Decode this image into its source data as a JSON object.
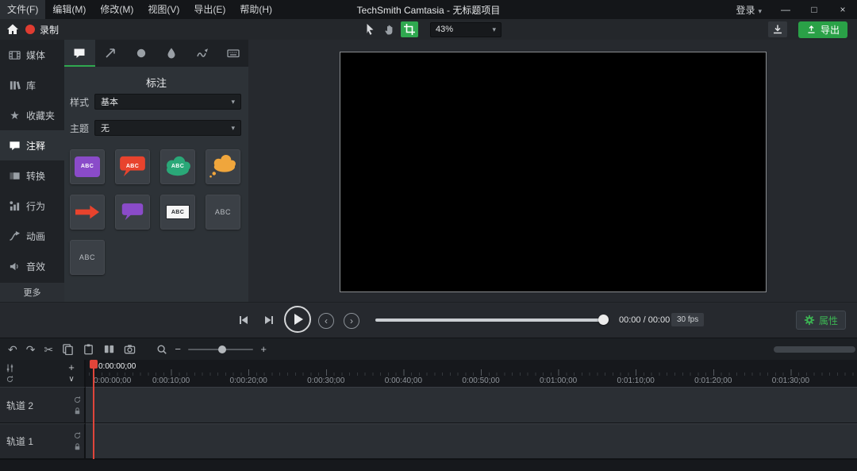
{
  "app": {
    "title": "TechSmith Camtasia - 无标题项目"
  },
  "menubar": {
    "items": [
      "文件(F)",
      "编辑(M)",
      "修改(M)",
      "视图(V)",
      "导出(E)",
      "帮助(H)"
    ],
    "login_label": "登录",
    "caret": "▾",
    "window": {
      "minimize": "—",
      "maximize": "□",
      "close": "×"
    }
  },
  "toolbar": {
    "record_label": "录制",
    "zoom_value": "43%",
    "caret": "▾",
    "export_label": "导出"
  },
  "sidebar": {
    "items": [
      {
        "label": "媒体",
        "icon": "media-icon"
      },
      {
        "label": "库",
        "icon": "library-icon"
      },
      {
        "label": "收藏夹",
        "icon": "star-icon",
        "glyph": "★"
      },
      {
        "label": "注释",
        "icon": "callout-icon",
        "selected": true
      },
      {
        "label": "转换",
        "icon": "transitions-icon"
      },
      {
        "label": "行为",
        "icon": "behaviors-icon"
      },
      {
        "label": "动画",
        "icon": "animations-icon"
      },
      {
        "label": "音效",
        "icon": "audio-icon"
      }
    ],
    "more_label": "更多"
  },
  "panel": {
    "title": "标注",
    "tabs": [
      "callout-icon",
      "arrow-icon",
      "shape-icon",
      "blur-icon",
      "sketch-motion-icon",
      "keystroke-icon"
    ],
    "style_label": "样式",
    "style_value": "基本",
    "theme_label": "主题",
    "theme_value": "无",
    "caret": "▾",
    "thumbnails": [
      {
        "label": "ABC",
        "shape": "rounded-rect",
        "color": "#8a4bc9"
      },
      {
        "label": "ABC",
        "shape": "speech-bubble",
        "color": "#e8432d"
      },
      {
        "label": "ABC",
        "shape": "cloud",
        "color": "#2aa878"
      },
      {
        "label": "",
        "shape": "thought-cloud",
        "color": "#f0a63c"
      },
      {
        "label": "",
        "shape": "arrow-right",
        "color": "#e8432d"
      },
      {
        "label": "",
        "shape": "speech-bubble",
        "color": "#8a4bc9"
      },
      {
        "label": "ABC",
        "shape": "text-box",
        "color": "#f5f5f5"
      },
      {
        "label": "ABC",
        "shape": "text-plain",
        "color": ""
      },
      {
        "label": "ABC",
        "shape": "text-plain",
        "color": ""
      }
    ]
  },
  "playback": {
    "time_display": "00:00 / 00:00",
    "fps_display": "30 fps",
    "properties_label": "属性"
  },
  "timeline": {
    "playhead_time": "0:00:00;00",
    "ruler_labels": [
      "0:00:00;00",
      "0:00:10;00",
      "0:00:20;00",
      "0:00:30;00",
      "0:00:40;00",
      "0:00:50;00",
      "0:01:00;00",
      "0:01:10;00",
      "0:01:20;00",
      "0:01:30;00"
    ],
    "tracks": [
      {
        "name": "轨道 2"
      },
      {
        "name": "轨道 1"
      }
    ],
    "add_track_label": "+",
    "collapse_label": "∨"
  },
  "colors": {
    "accent_green": "#2fa84f",
    "record_red": "#e03c31",
    "playhead_red": "#e0453a",
    "export_green": "#2aa147"
  }
}
